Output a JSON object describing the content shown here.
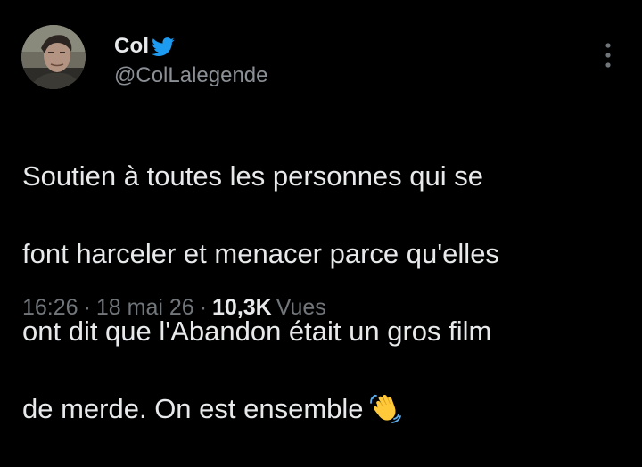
{
  "author": {
    "display_name": "Col",
    "handle": "@ColLalegende",
    "badge_icon": "twitter-bird-icon",
    "badge_color": "#1d9bf0"
  },
  "tweet": {
    "lines": [
      "Soutien à toutes les personnes qui se",
      "font harceler et menacer parce qu'elles",
      "ont dit que l'Abandon était un gros film",
      "de merde. On est ensemble"
    ],
    "emoji_icon": "waving-hand-icon"
  },
  "meta": {
    "time": "16:26",
    "separator": "·",
    "date": "18 mai 26",
    "views_count": "10,3K",
    "views_label": "Vues"
  },
  "menu": {
    "icon": "more-vertical-icon"
  },
  "colors": {
    "background": "#000000",
    "text_primary": "#e7e9ea",
    "text_secondary": "#71767b"
  }
}
